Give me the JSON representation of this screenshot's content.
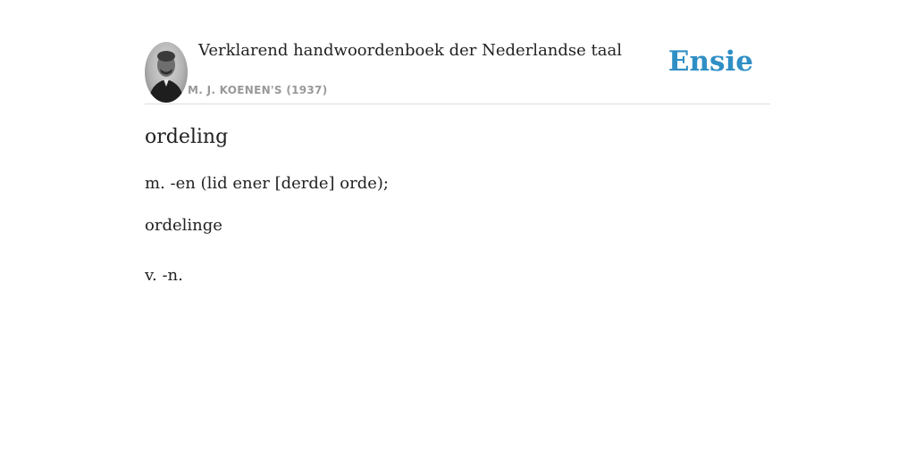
{
  "header": {
    "book_title": "Verklarend handwoordenboek der Nederlandse taal",
    "author": "M. J. KOENEN'S (1937)",
    "brand": "Ensie",
    "brand_color": "#2f8fc5"
  },
  "entry": {
    "headword": "ordeling",
    "definition": "m. -en (lid ener [derde] orde);",
    "variant": "ordelinge",
    "variant_definition": "v. -n."
  }
}
